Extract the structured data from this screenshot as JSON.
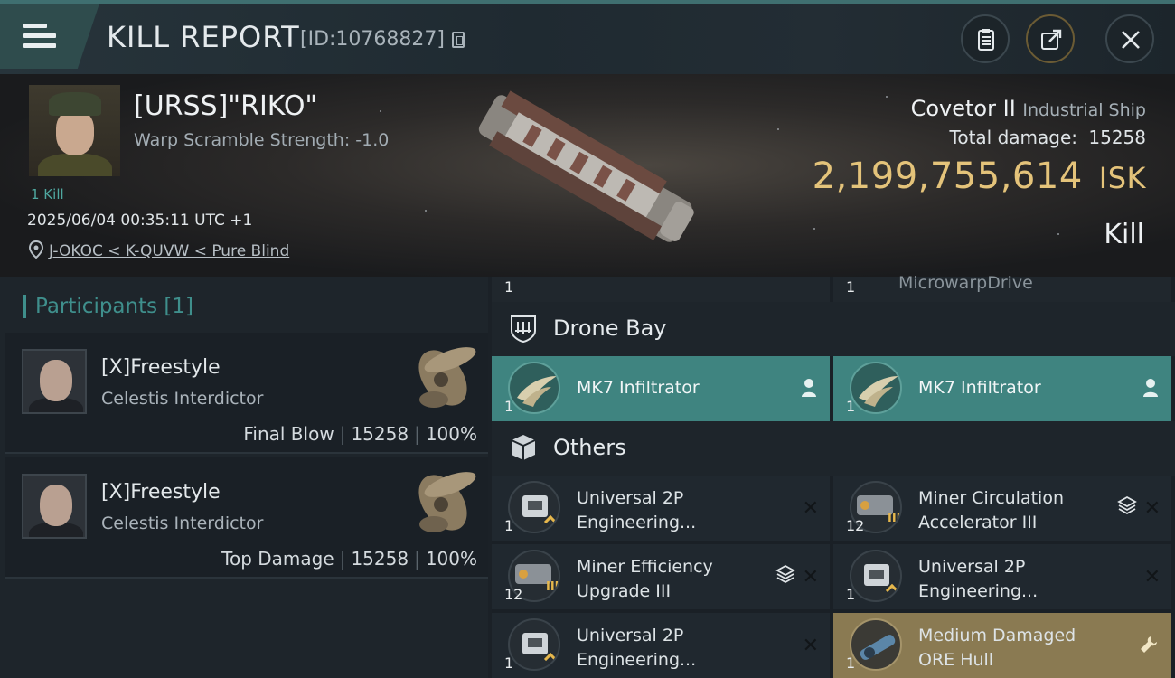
{
  "header": {
    "title": "KILL REPORT",
    "report_id": "[ID:10768827]"
  },
  "victim": {
    "pilot": "[URSS]\"RIKO\"",
    "warp_scramble": "Warp Scramble Strength: -1.0",
    "kills": "1 Kill",
    "datetime": "2025/06/04 00:35:11 UTC +1",
    "location": "J-OKOC < K-QUVW < Pure Blind",
    "ship_name": "Covetor II",
    "ship_class": "Industrial Ship",
    "total_damage_label": "Total damage:",
    "total_damage": "15258",
    "isk_value": "2,199,755,614",
    "isk_unit": "ISK",
    "kill_type": "Kill"
  },
  "participants": {
    "header": "Participants [1]",
    "items": [
      {
        "name": "[X]Freestyle",
        "ship": "Celestis Interdictor",
        "role": "Final Blow",
        "damage": "15258",
        "percent": "100%"
      },
      {
        "name": "[X]Freestyle",
        "ship": "Celestis Interdictor",
        "role": "Top Damage",
        "damage": "15258",
        "percent": "100%"
      }
    ]
  },
  "high_slots": [
    {
      "qty": "1",
      "name": ""
    },
    {
      "qty": "1",
      "name": "MicrowarpDrive"
    }
  ],
  "drone_bay": {
    "title": "Drone Bay",
    "items": [
      {
        "qty": "1",
        "name": "MK7 Infiltrator"
      },
      {
        "qty": "1",
        "name": "MK7 Infiltrator"
      }
    ]
  },
  "others": {
    "title": "Others",
    "items": [
      {
        "qty": "1",
        "name_line1": "Universal 2P",
        "name_line2": "Engineering..."
      },
      {
        "qty": "12",
        "name_line1": "Miner Circulation",
        "name_line2": "Accelerator III"
      },
      {
        "qty": "12",
        "name_line1": "Miner Efficiency",
        "name_line2": "Upgrade III"
      },
      {
        "qty": "1",
        "name_line1": "Universal 2P",
        "name_line2": "Engineering..."
      },
      {
        "qty": "1",
        "name_line1": "Universal 2P",
        "name_line2": "Engineering..."
      },
      {
        "qty": "1",
        "name_line1": "Medium Damaged",
        "name_line2": "ORE Hull"
      }
    ]
  },
  "colors": {
    "accent_teal": "#3f8480",
    "isk_gold": "#e4c37a",
    "damaged_item": "#8a7a52"
  }
}
